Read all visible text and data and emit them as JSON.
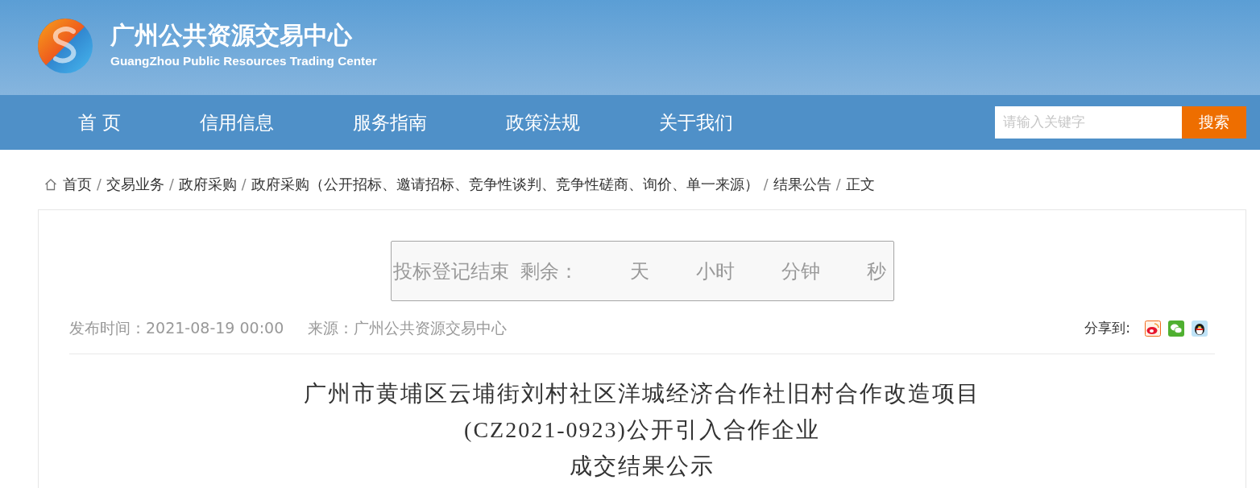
{
  "header": {
    "title": "广州公共资源交易中心",
    "subtitle": "GuangZhou Public Resources Trading Center"
  },
  "nav": {
    "items": [
      {
        "label": "首 页"
      },
      {
        "label": "信用信息"
      },
      {
        "label": "服务指南"
      },
      {
        "label": "政策法规"
      },
      {
        "label": "关于我们"
      }
    ],
    "search": {
      "placeholder": "请输入关键字",
      "button": "搜索"
    }
  },
  "breadcrumb": [
    {
      "label": "首页",
      "separator": "/"
    },
    {
      "label": "交易业务",
      "separator": "/"
    },
    {
      "label": "政府采购",
      "separator": "/"
    },
    {
      "label": "政府采购（公开招标、邀请招标、竞争性谈判、竞争性磋商、询价、单一来源）",
      "separator": "/"
    },
    {
      "label": "结果公告",
      "separator": "/"
    },
    {
      "label": "正文"
    }
  ],
  "countdown": {
    "label": "投标登记结束",
    "remaining_label": "剩余：",
    "units": [
      "天",
      "小时",
      "分钟",
      "秒"
    ]
  },
  "meta": {
    "published": "发布时间：2021-08-19 00:00",
    "source": "来源：广州公共资源交易中心",
    "share_label": "分享到:"
  },
  "article": {
    "title_lines": [
      "广州市黄埔区云埔街刘村社区洋城经济合作社旧村合作改造项目",
      "(CZ2021-0923)公开引入合作企业",
      "成交结果公示"
    ]
  }
}
